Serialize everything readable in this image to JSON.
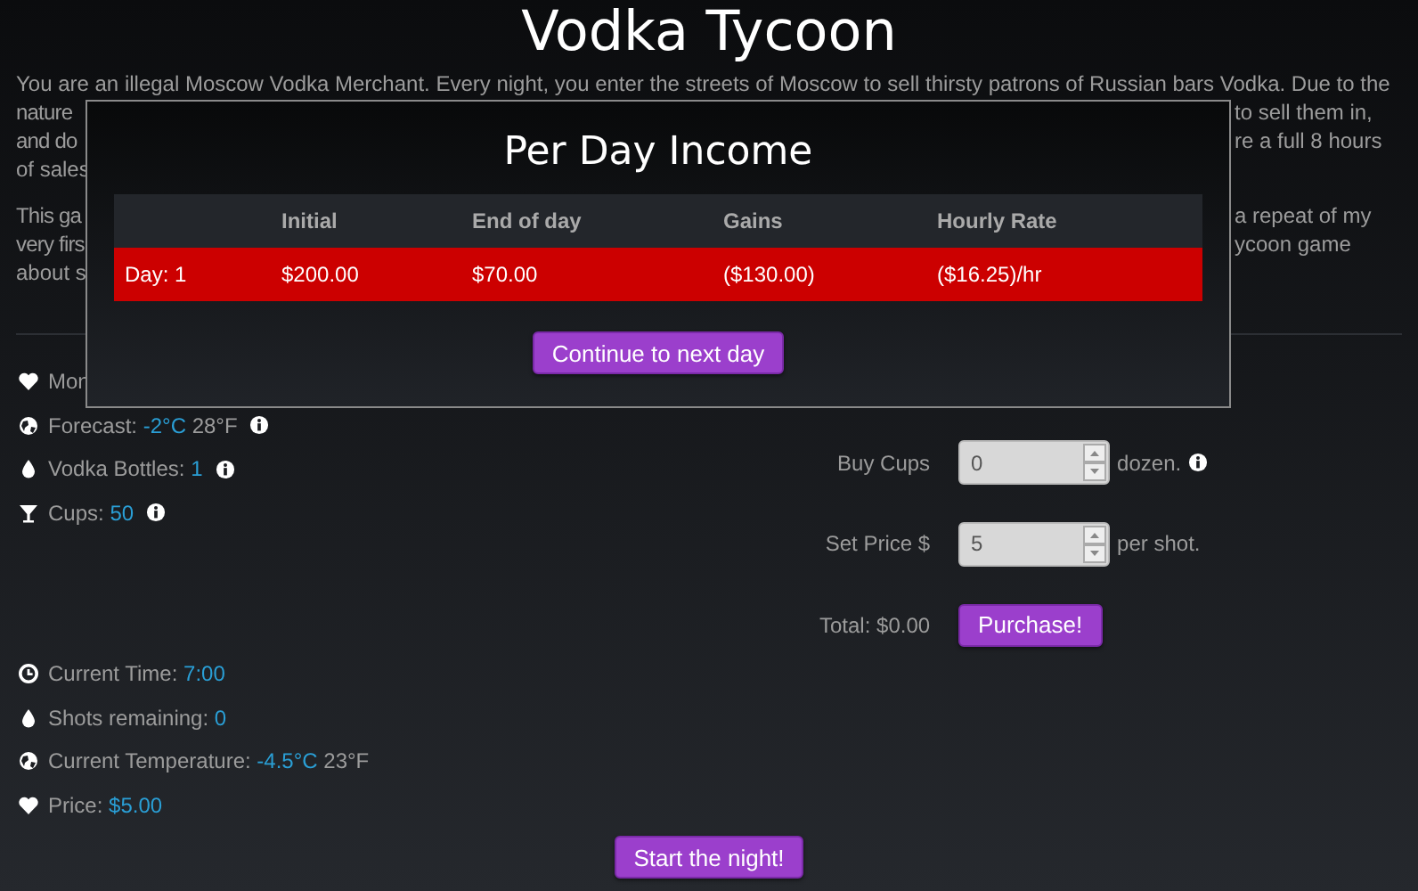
{
  "title": "Vodka Tycoon",
  "intro": [
    {
      "lines": [
        {
          "left": "You are an illegal Moscow Vodka Merchant. Every night, you enter the streets of Moscow to sell thirsty patrons of Russian bars Vodka. Due to the"
        },
        {
          "left": "nature",
          "right": "to sell them in,"
        },
        {
          "left": "and do",
          "right": "re a full 8 hours"
        },
        {
          "left": "of sales"
        }
      ]
    },
    {
      "lines": [
        {
          "left": "This ga",
          "right": "a repeat of my"
        },
        {
          "left": "very firs",
          "right": "ycoon game"
        },
        {
          "left": "about s"
        }
      ]
    }
  ],
  "stats": [
    {
      "kind": "heart",
      "label": "Mon"
    },
    {
      "kind": "globe",
      "label": "Forecast:",
      "value": "-2°C",
      "extra": "28°F",
      "info": true
    },
    {
      "kind": "drop",
      "label": "Vodka Bottles:",
      "value": "1",
      "info": true
    },
    {
      "kind": "glass",
      "label": "Cups:",
      "value": "50",
      "info": true
    }
  ],
  "purchase_form": {
    "fields": [
      {
        "label": "Buy Cups",
        "value": "0",
        "suffix": "dozen.",
        "info": true
      },
      {
        "label": "Set Price $",
        "value": "5",
        "suffix": "per shot.",
        "info": false
      }
    ],
    "total": "Total: $0.00",
    "button": "Purchase!"
  },
  "night_stats": [
    {
      "kind": "clock",
      "label": "Current Time:",
      "value": "7:00"
    },
    {
      "kind": "drop",
      "label": "Shots remaining:",
      "value": "0"
    },
    {
      "kind": "globe",
      "label": "Current Temperature:",
      "value": "-4.5°C",
      "extra": "23°F"
    },
    {
      "kind": "heart",
      "label": "Price:",
      "value": "$5.00"
    }
  ],
  "start_button": "Start the night!",
  "dialog": {
    "title": "Per Day Income",
    "columns": [
      "",
      "Initial",
      "End of day",
      "Gains",
      "Hourly Rate"
    ],
    "rows": [
      {
        "cells": [
          "Day: 1",
          "$200.00",
          "$70.00",
          "($130.00)",
          "($16.25)/hr"
        ],
        "negative": true
      }
    ],
    "button": "Continue to next day"
  }
}
